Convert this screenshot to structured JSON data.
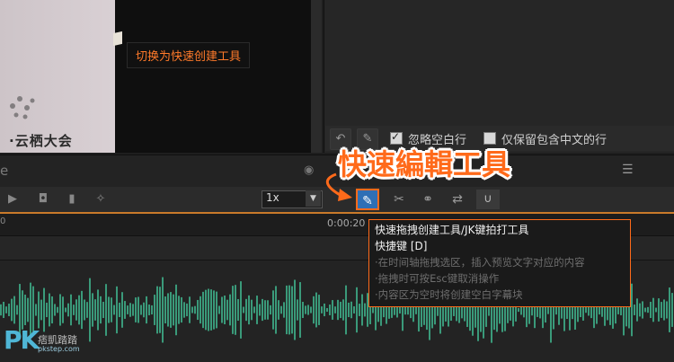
{
  "preview": {
    "brand_text": "·云栖大会",
    "switch_tooltip": "切换为快速创建工具"
  },
  "subtitle_toolbar": {
    "undo_icon": "undo-icon",
    "edit_icon": "pencil-icon",
    "ignore_blank_label": "忽略空白行",
    "ignore_blank_checked": true,
    "keep_chinese_label": "仅保留包含中文的行",
    "keep_chinese_checked": false
  },
  "timeline_header": {
    "name_partial": "e",
    "callout": "快速編輯工具"
  },
  "timeline_toolbar": {
    "zoom_value": "1x",
    "zoom_arrow": "▼",
    "icons": [
      "play-icon",
      "camera-icon",
      "bookmark-icon",
      "magic-wand-icon",
      "create-tool-icon",
      "scissors-icon",
      "link-icon",
      "swap-icon",
      "magnet-icon"
    ]
  },
  "ruler": {
    "start": "0",
    "mark": "0:00:20"
  },
  "help_tooltip": {
    "title": "快速拖拽创建工具/JK键拍打工具",
    "shortcut": "快捷键 [D]",
    "lines": [
      "·在时间轴拖拽选区，插入预览文字对应的内容",
      "·拖拽时可按Esc键取消操作",
      "·内容区为空时将创建空白字幕块"
    ]
  },
  "watermark": {
    "logo": "PK",
    "text": "痞凱踏踏",
    "sub": "pkstep.com"
  },
  "colors": {
    "accent": "#ff6a1a",
    "waveform": "#3a9a7a",
    "active_button": "#2f6fb5"
  }
}
